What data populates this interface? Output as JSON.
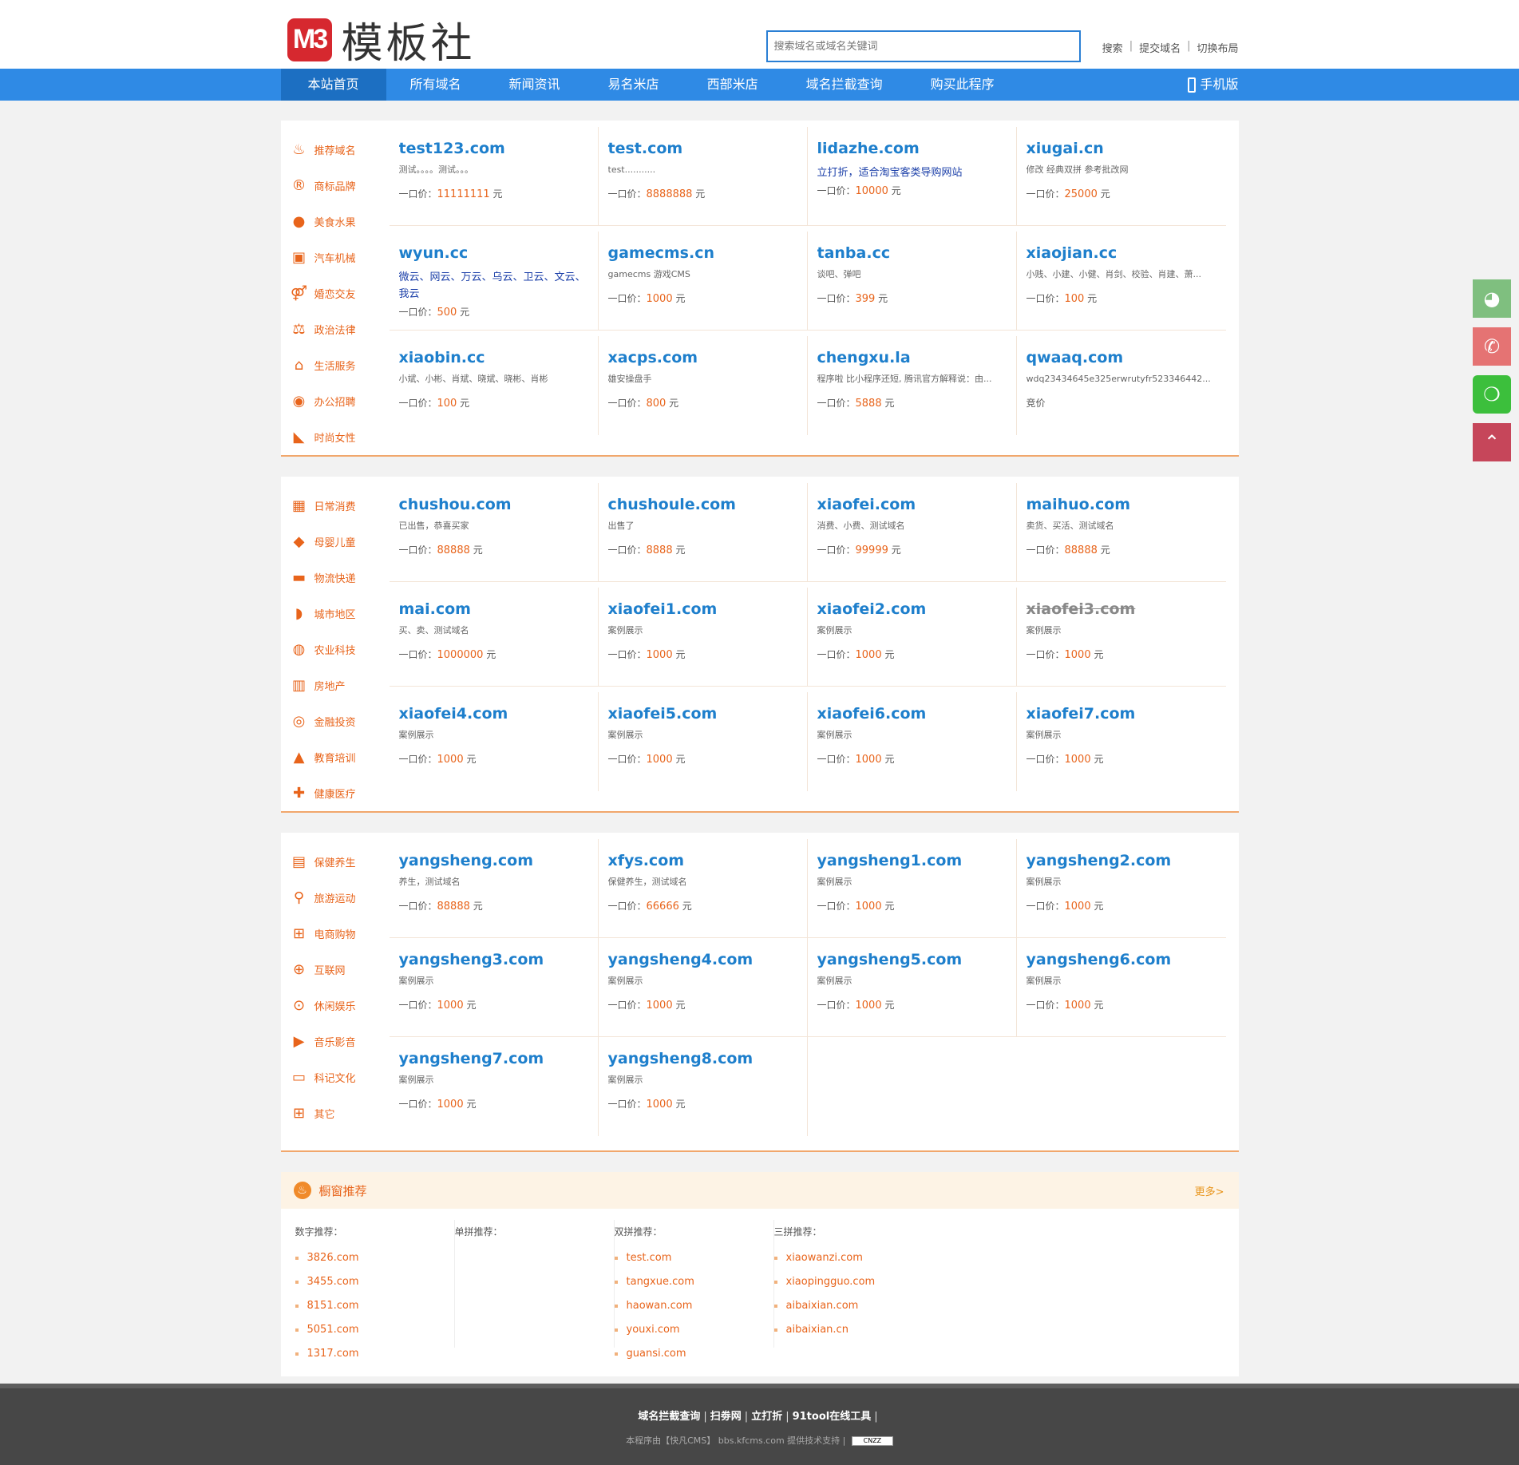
{
  "header": {
    "logo_mark": "M3",
    "logo_text": "模板社",
    "search_placeholder": "搜索域名或域名关键词",
    "links": [
      "搜索",
      "提交域名",
      "切换布局"
    ]
  },
  "nav": {
    "items": [
      "本站首页",
      "所有域名",
      "新闻资讯",
      "易名米店",
      "西部米店",
      "域名拦截查询",
      "购买此程序"
    ],
    "mobile": "手机版"
  },
  "sections": [
    {
      "categories": [
        {
          "label": "推荐域名",
          "icon": "fire-icon",
          "glyph": "♨"
        },
        {
          "label": "商标品牌",
          "icon": "registered-icon",
          "glyph": "®"
        },
        {
          "label": "美食水果",
          "icon": "apple-icon",
          "glyph": "●"
        },
        {
          "label": "汽车机械",
          "icon": "car-icon",
          "glyph": "▣"
        },
        {
          "label": "婚恋交友",
          "icon": "gender-icon",
          "glyph": "⚤"
        },
        {
          "label": "政治法律",
          "icon": "scale-icon",
          "glyph": "⚖"
        },
        {
          "label": "生活服务",
          "icon": "home-icon",
          "glyph": "⌂"
        },
        {
          "label": "办公招聘",
          "icon": "hire-icon",
          "glyph": "◉"
        },
        {
          "label": "时尚女性",
          "icon": "heel-icon",
          "glyph": "◣"
        }
      ],
      "domains": [
        {
          "name": "test123.com",
          "desc": "测试。。。。测试。。。",
          "price_label": "一口价：",
          "price": "11111111",
          "unit": "元"
        },
        {
          "name": "test.com",
          "desc": "test...........",
          "price_label": "一口价：",
          "price": "8888888",
          "unit": "元"
        },
        {
          "name": "lidazhe.com",
          "desc": "立打折，适合淘宝客类导购网站",
          "desc_style": "blue",
          "price_label": "一口价：",
          "price": "10000",
          "unit": "元"
        },
        {
          "name": "xiugai.cn",
          "desc": "修改 经典双拼 参考批改网",
          "price_label": "一口价：",
          "price": "25000",
          "unit": "元"
        },
        {
          "name": "wyun.cc",
          "desc": "微云、网云、万云、乌云、卫云、文云、我云",
          "desc_style": "blue",
          "price_label": "一口价：",
          "price": "500",
          "unit": "元"
        },
        {
          "name": "gamecms.cn",
          "desc": "gamecms 游戏CMS",
          "price_label": "一口价：",
          "price": "1000",
          "unit": "元"
        },
        {
          "name": "tanba.cc",
          "desc": "谈吧、弹吧",
          "price_label": "一口价：",
          "price": "399",
          "unit": "元"
        },
        {
          "name": "xiaojian.cc",
          "desc": "小贱、小建、小健、肖剑、校验、肖建、萧...",
          "price_label": "一口价：",
          "price": "100",
          "unit": "元"
        },
        {
          "name": "xiaobin.cc",
          "desc": "小斌、小彬、肖斌、晓斌、晓彬、肖彬",
          "price_label": "一口价：",
          "price": "100",
          "unit": "元"
        },
        {
          "name": "xacps.com",
          "desc": "雄安操盘手",
          "price_label": "一口价：",
          "price": "800",
          "unit": "元"
        },
        {
          "name": "chengxu.la",
          "desc": "程序啦 比小程序还短, 腾讯官方解释说：由...",
          "price_label": "一口价：",
          "price": "5888",
          "unit": "元"
        },
        {
          "name": "qwaaq.com",
          "desc": "wdq23434645e325erwrutyfr523346442...",
          "price_label": "竞价",
          "price": "",
          "unit": ""
        }
      ]
    },
    {
      "categories": [
        {
          "label": "日常消费",
          "icon": "gift-icon",
          "glyph": "▦"
        },
        {
          "label": "母婴儿童",
          "icon": "tag-icon",
          "glyph": "◆"
        },
        {
          "label": "物流快递",
          "icon": "truck-icon",
          "glyph": "▬"
        },
        {
          "label": "城市地区",
          "icon": "map-icon",
          "glyph": "◗"
        },
        {
          "label": "农业科技",
          "icon": "seed-icon",
          "glyph": "◍"
        },
        {
          "label": "房地产",
          "icon": "building-icon",
          "glyph": "▥"
        },
        {
          "label": "金融投资",
          "icon": "moneybag-icon",
          "glyph": "◎"
        },
        {
          "label": "教育培训",
          "icon": "graduation-cap-icon",
          "glyph": "▲"
        },
        {
          "label": "健康医疗",
          "icon": "medkit-icon",
          "glyph": "✚"
        }
      ],
      "domains": [
        {
          "name": "chushou.com",
          "desc": "已出售，恭喜买家",
          "price_label": "一口价：",
          "price": "88888",
          "unit": "元"
        },
        {
          "name": "chushoule.com",
          "desc": "出售了",
          "price_label": "一口价：",
          "price": "8888",
          "unit": "元"
        },
        {
          "name": "xiaofei.com",
          "desc": "消费、小费、测试域名",
          "price_label": "一口价：",
          "price": "99999",
          "unit": "元"
        },
        {
          "name": "maihuo.com",
          "desc": "卖货、买活、测试域名",
          "price_label": "一口价：",
          "price": "88888",
          "unit": "元"
        },
        {
          "name": "mai.com",
          "desc": "买、卖、测试域名",
          "price_label": "一口价：",
          "price": "1000000",
          "unit": "元"
        },
        {
          "name": "xiaofei1.com",
          "desc": "案例展示",
          "price_label": "一口价：",
          "price": "1000",
          "unit": "元"
        },
        {
          "name": "xiaofei2.com",
          "desc": "案例展示",
          "price_label": "一口价：",
          "price": "1000",
          "unit": "元"
        },
        {
          "name": "xiaofei3.com",
          "desc": "案例展示",
          "strike": true,
          "price_label": "一口价：",
          "price": "1000",
          "unit": "元"
        },
        {
          "name": "xiaofei4.com",
          "desc": "案例展示",
          "price_label": "一口价：",
          "price": "1000",
          "unit": "元"
        },
        {
          "name": "xiaofei5.com",
          "desc": "案例展示",
          "price_label": "一口价：",
          "price": "1000",
          "unit": "元"
        },
        {
          "name": "xiaofei6.com",
          "desc": "案例展示",
          "price_label": "一口价：",
          "price": "1000",
          "unit": "元"
        },
        {
          "name": "xiaofei7.com",
          "desc": "案例展示",
          "price_label": "一口价：",
          "price": "1000",
          "unit": "元"
        }
      ]
    },
    {
      "categories": [
        {
          "label": "保健养生",
          "icon": "bottle-icon",
          "glyph": "▤"
        },
        {
          "label": "旅游运动",
          "icon": "bike-icon",
          "glyph": "⚲"
        },
        {
          "label": "电商购物",
          "icon": "cart-icon",
          "glyph": "⊞"
        },
        {
          "label": "互联网",
          "icon": "globe-icon",
          "glyph": "⊕"
        },
        {
          "label": "休闲娱乐",
          "icon": "gamepad-icon",
          "glyph": "⊙"
        },
        {
          "label": "音乐影音",
          "icon": "play-icon",
          "glyph": "▶"
        },
        {
          "label": "科记文化",
          "icon": "book-icon",
          "glyph": "▭"
        },
        {
          "label": "其它",
          "icon": "grid-icon",
          "glyph": "⊞"
        }
      ],
      "domains": [
        {
          "name": "yangsheng.com",
          "desc": "养生，测试域名",
          "price_label": "一口价：",
          "price": "88888",
          "unit": "元"
        },
        {
          "name": "xfys.com",
          "desc": "保健养生，测试域名",
          "price_label": "一口价：",
          "price": "66666",
          "unit": "元"
        },
        {
          "name": "yangsheng1.com",
          "desc": "案例展示",
          "price_label": "一口价：",
          "price": "1000",
          "unit": "元"
        },
        {
          "name": "yangsheng2.com",
          "desc": "案例展示",
          "price_label": "一口价：",
          "price": "1000",
          "unit": "元"
        },
        {
          "name": "yangsheng3.com",
          "desc": "案例展示",
          "price_label": "一口价：",
          "price": "1000",
          "unit": "元"
        },
        {
          "name": "yangsheng4.com",
          "desc": "案例展示",
          "price_label": "一口价：",
          "price": "1000",
          "unit": "元"
        },
        {
          "name": "yangsheng5.com",
          "desc": "案例展示",
          "price_label": "一口价：",
          "price": "1000",
          "unit": "元"
        },
        {
          "name": "yangsheng6.com",
          "desc": "案例展示",
          "price_label": "一口价：",
          "price": "1000",
          "unit": "元"
        },
        {
          "name": "yangsheng7.com",
          "desc": "案例展示",
          "price_label": "一口价：",
          "price": "1000",
          "unit": "元"
        },
        {
          "name": "yangsheng8.com",
          "desc": "案例展示",
          "price_label": "一口价：",
          "price": "1000",
          "unit": "元"
        }
      ]
    }
  ],
  "recommend": {
    "title": "橱窗推荐",
    "more": "更多>",
    "columns": [
      {
        "heading": "数字推荐：",
        "items": [
          "3826.com",
          "3455.com",
          "8151.com",
          "5051.com",
          "1317.com"
        ]
      },
      {
        "heading": "单拼推荐：",
        "items": []
      },
      {
        "heading": "双拼推荐：",
        "items": [
          "test.com",
          "tangxue.com",
          "haowan.com",
          "youxi.com",
          "guansi.com"
        ]
      },
      {
        "heading": "三拼推荐：",
        "items": [
          "xiaowanzi.com",
          "xiaopingguo.com",
          "aibaixian.com",
          "aibaixian.cn"
        ]
      }
    ]
  },
  "footer": {
    "links": [
      "域名拦截查询",
      "扫劵网",
      "立打折",
      "91tool在线工具"
    ],
    "copyright": "本程序由【快凡CMS】 bbs.kfcms.com 提供技术支持 |",
    "badge": "CNZZ"
  },
  "colors": {
    "accent": "#2f8ae5",
    "nav_active": "#1c6fc2",
    "domain": "#1e7fcc",
    "price": "#e8641b",
    "section_border": "#f1a76c"
  },
  "float_buttons": [
    "qq-icon",
    "phone-icon",
    "wechat-icon",
    "back-to-top-icon"
  ]
}
